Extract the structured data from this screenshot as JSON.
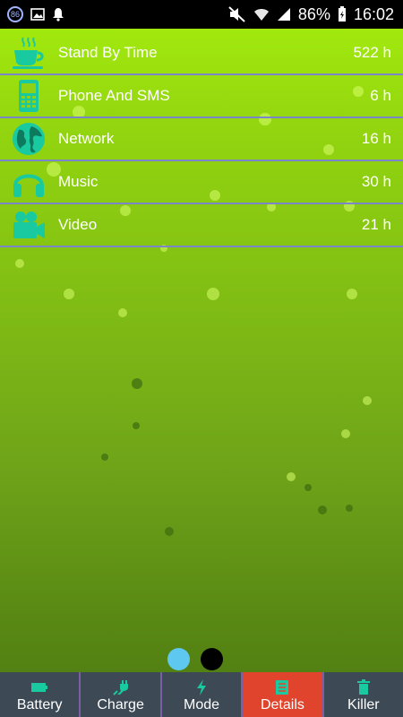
{
  "status_bar": {
    "badge": "86",
    "battery_percent": "86%",
    "time": "16:02"
  },
  "list": [
    {
      "icon": "coffee-cup-icon",
      "label": "Stand By Time",
      "value": "522 h"
    },
    {
      "icon": "phone-icon",
      "label": "Phone And SMS",
      "value": "6 h"
    },
    {
      "icon": "globe-icon",
      "label": "Network",
      "value": "16 h"
    },
    {
      "icon": "headphones-icon",
      "label": "Music",
      "value": "30 h"
    },
    {
      "icon": "video-camera-icon",
      "label": "Video",
      "value": "21 h"
    }
  ],
  "page_indicator": {
    "current": 1,
    "total": 2
  },
  "tabs": [
    {
      "icon": "battery-icon",
      "label": "Battery",
      "active": false
    },
    {
      "icon": "plug-icon",
      "label": "Charge",
      "active": false
    },
    {
      "icon": "bolt-icon",
      "label": "Mode",
      "active": false
    },
    {
      "icon": "document-icon",
      "label": "Details",
      "active": true
    },
    {
      "icon": "trash-icon",
      "label": "Killer",
      "active": false
    }
  ],
  "colors": {
    "icon_teal": "#19c9a0",
    "active_tab": "#e0442d",
    "tabbar": "#3d4a55",
    "dot_active": "#5ec8f0",
    "dot_inactive": "#000000"
  }
}
